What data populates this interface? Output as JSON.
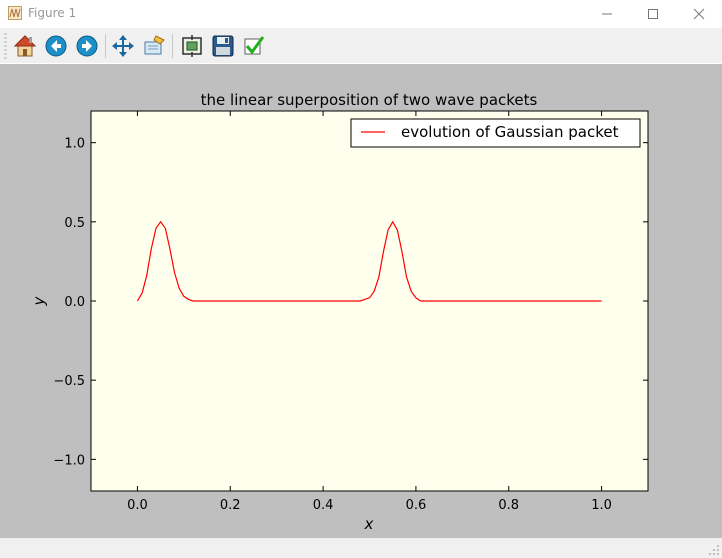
{
  "window": {
    "title": "Figure 1",
    "controls": [
      "minimize",
      "maximize",
      "close"
    ]
  },
  "toolbar": {
    "buttons": [
      {
        "name": "home",
        "icon": "home-icon"
      },
      {
        "name": "back",
        "icon": "back-arrow-icon"
      },
      {
        "name": "forward",
        "icon": "forward-arrow-icon"
      },
      {
        "name": "pan",
        "icon": "pan-move-icon"
      },
      {
        "name": "zoom",
        "icon": "zoom-rect-icon"
      },
      {
        "name": "subplots",
        "icon": "configure-subplots-icon"
      },
      {
        "name": "save",
        "icon": "floppy-save-icon"
      },
      {
        "name": "edit",
        "icon": "checkmark-icon"
      }
    ]
  },
  "colors": {
    "plot_background": "#ffffee",
    "canvas_background": "#bfbfbf",
    "line": "#ff0000"
  },
  "chart_data": {
    "type": "line",
    "title": "the linear superposition of two wave packets",
    "xlabel": "x",
    "ylabel": "y",
    "xlim": [
      -0.1,
      1.1
    ],
    "ylim": [
      -1.2,
      1.2
    ],
    "xticks": [
      "0.0",
      "0.2",
      "0.4",
      "0.6",
      "0.8",
      "1.0"
    ],
    "yticks": [
      "1.0",
      "0.5",
      "0.0",
      "−0.5",
      "−1.0"
    ],
    "legend": {
      "position": "upper-right"
    },
    "series": [
      {
        "name": "evolution of Gaussian packet",
        "color": "#ff0000",
        "x": [
          0.0,
          0.01,
          0.02,
          0.03,
          0.04,
          0.05,
          0.06,
          0.07,
          0.08,
          0.09,
          0.1,
          0.11,
          0.12,
          0.14,
          0.2,
          0.3,
          0.4,
          0.45,
          0.48,
          0.5,
          0.51,
          0.52,
          0.53,
          0.54,
          0.55,
          0.56,
          0.57,
          0.58,
          0.59,
          0.6,
          0.61,
          0.62,
          0.64,
          0.7,
          0.8,
          0.9,
          1.0
        ],
        "y": [
          0.0,
          0.05,
          0.16,
          0.33,
          0.46,
          0.5,
          0.46,
          0.33,
          0.18,
          0.08,
          0.03,
          0.01,
          0.0,
          0.0,
          0.0,
          0.0,
          0.0,
          0.0,
          0.0,
          0.02,
          0.06,
          0.15,
          0.31,
          0.45,
          0.5,
          0.45,
          0.31,
          0.15,
          0.06,
          0.02,
          0.0,
          0.0,
          0.0,
          0.0,
          0.0,
          0.0,
          0.0
        ]
      }
    ]
  }
}
